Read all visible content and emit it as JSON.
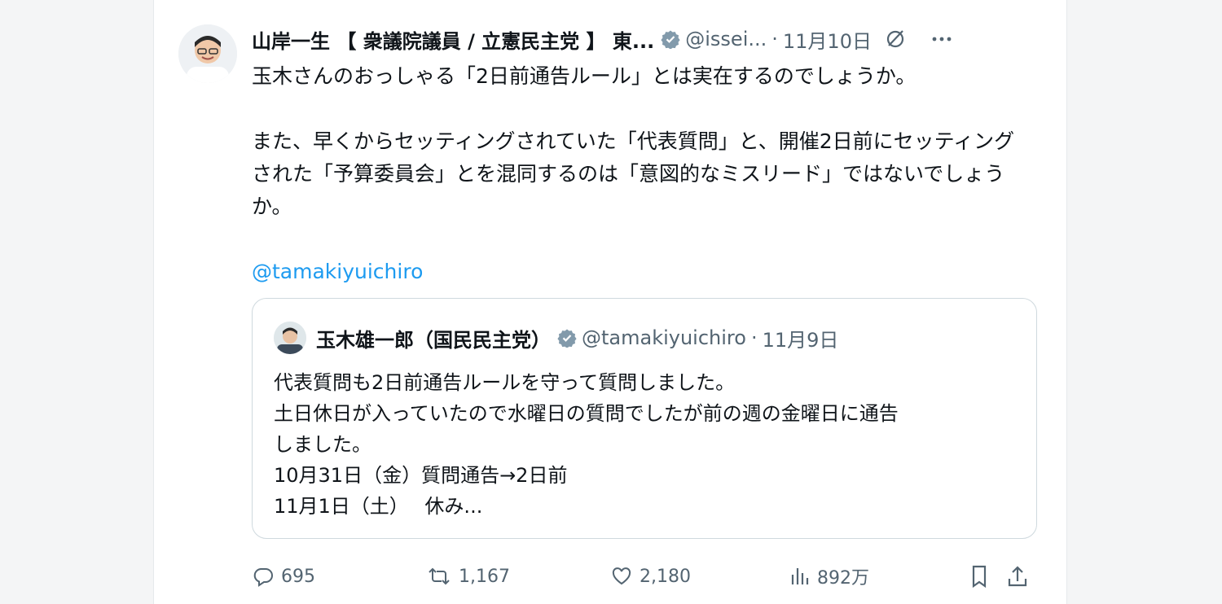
{
  "post": {
    "author_name": "山岸一生 【 衆議院議員 / 立憲民主党 】 東...",
    "handle": "@issei...",
    "separator": "·",
    "date": "11月10日",
    "paragraphs": [
      "玉木さんのおっしゃる「2日前通告ルール」とは実在するのでしょうか。",
      "また、早くからセッティングされていた「代表質問」と、開催2日前にセッティングされた「予算委員会」とを混同するのは「意図的なミスリード」ではないでしょうか。"
    ],
    "mention": "@tamakiyuichiro"
  },
  "quoted": {
    "author_name": "玉木雄一郎（国民民主党）",
    "handle": "@tamakiyuichiro",
    "separator": "·",
    "date": "11月9日",
    "lines": [
      "代表質問も2日前通告ルールを守って質問しました。",
      "土日休日が入っていたので水曜日の質問でしたが前の週の金曜日に通告",
      "しました。",
      "10月31日（金）質問通告→2日前",
      "11月1日（土）　 休み..."
    ]
  },
  "actions": {
    "replies": "695",
    "reposts": "1,167",
    "likes": "2,180",
    "views": "892万"
  },
  "colors": {
    "accent": "#1d9bf0",
    "muted": "#536471",
    "text": "#0f1419",
    "border": "#cfd9de"
  },
  "icons": [
    "verified-badge-icon",
    "grok-icon",
    "more-icon",
    "reply-icon",
    "repost-icon",
    "like-icon",
    "views-icon",
    "bookmark-icon",
    "share-icon"
  ]
}
